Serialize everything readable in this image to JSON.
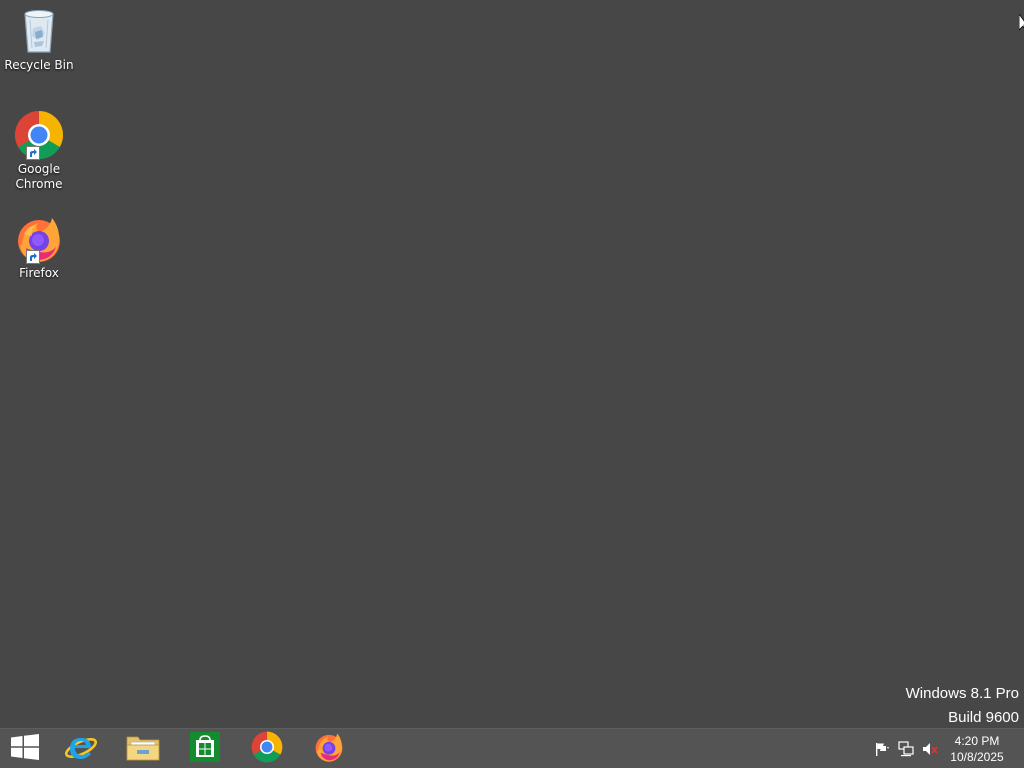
{
  "desktop": {
    "icons": [
      {
        "label": "Recycle Bin",
        "icon": "recycle-bin-icon"
      },
      {
        "label": "Google Chrome",
        "icon": "chrome-icon",
        "shortcut": true
      },
      {
        "label": "Firefox",
        "icon": "firefox-icon",
        "shortcut": true
      }
    ],
    "background_color": "#474747"
  },
  "watermark": {
    "line1": "Windows 8.1 Pro",
    "line2": "Build 9600"
  },
  "taskbar": {
    "pinned": [
      {
        "name": "start",
        "icon": "windows-logo-icon"
      },
      {
        "name": "internet-explorer",
        "icon": "ie-icon"
      },
      {
        "name": "file-explorer",
        "icon": "folder-icon"
      },
      {
        "name": "store",
        "icon": "store-icon"
      },
      {
        "name": "chrome",
        "icon": "chrome-icon"
      },
      {
        "name": "firefox",
        "icon": "firefox-icon"
      }
    ],
    "tray": {
      "icons": [
        "action-center-flag-icon",
        "network-icon",
        "volume-muted-icon"
      ],
      "time": "4:20 PM",
      "date": "10/8/2025"
    },
    "background_color": "#545454"
  }
}
